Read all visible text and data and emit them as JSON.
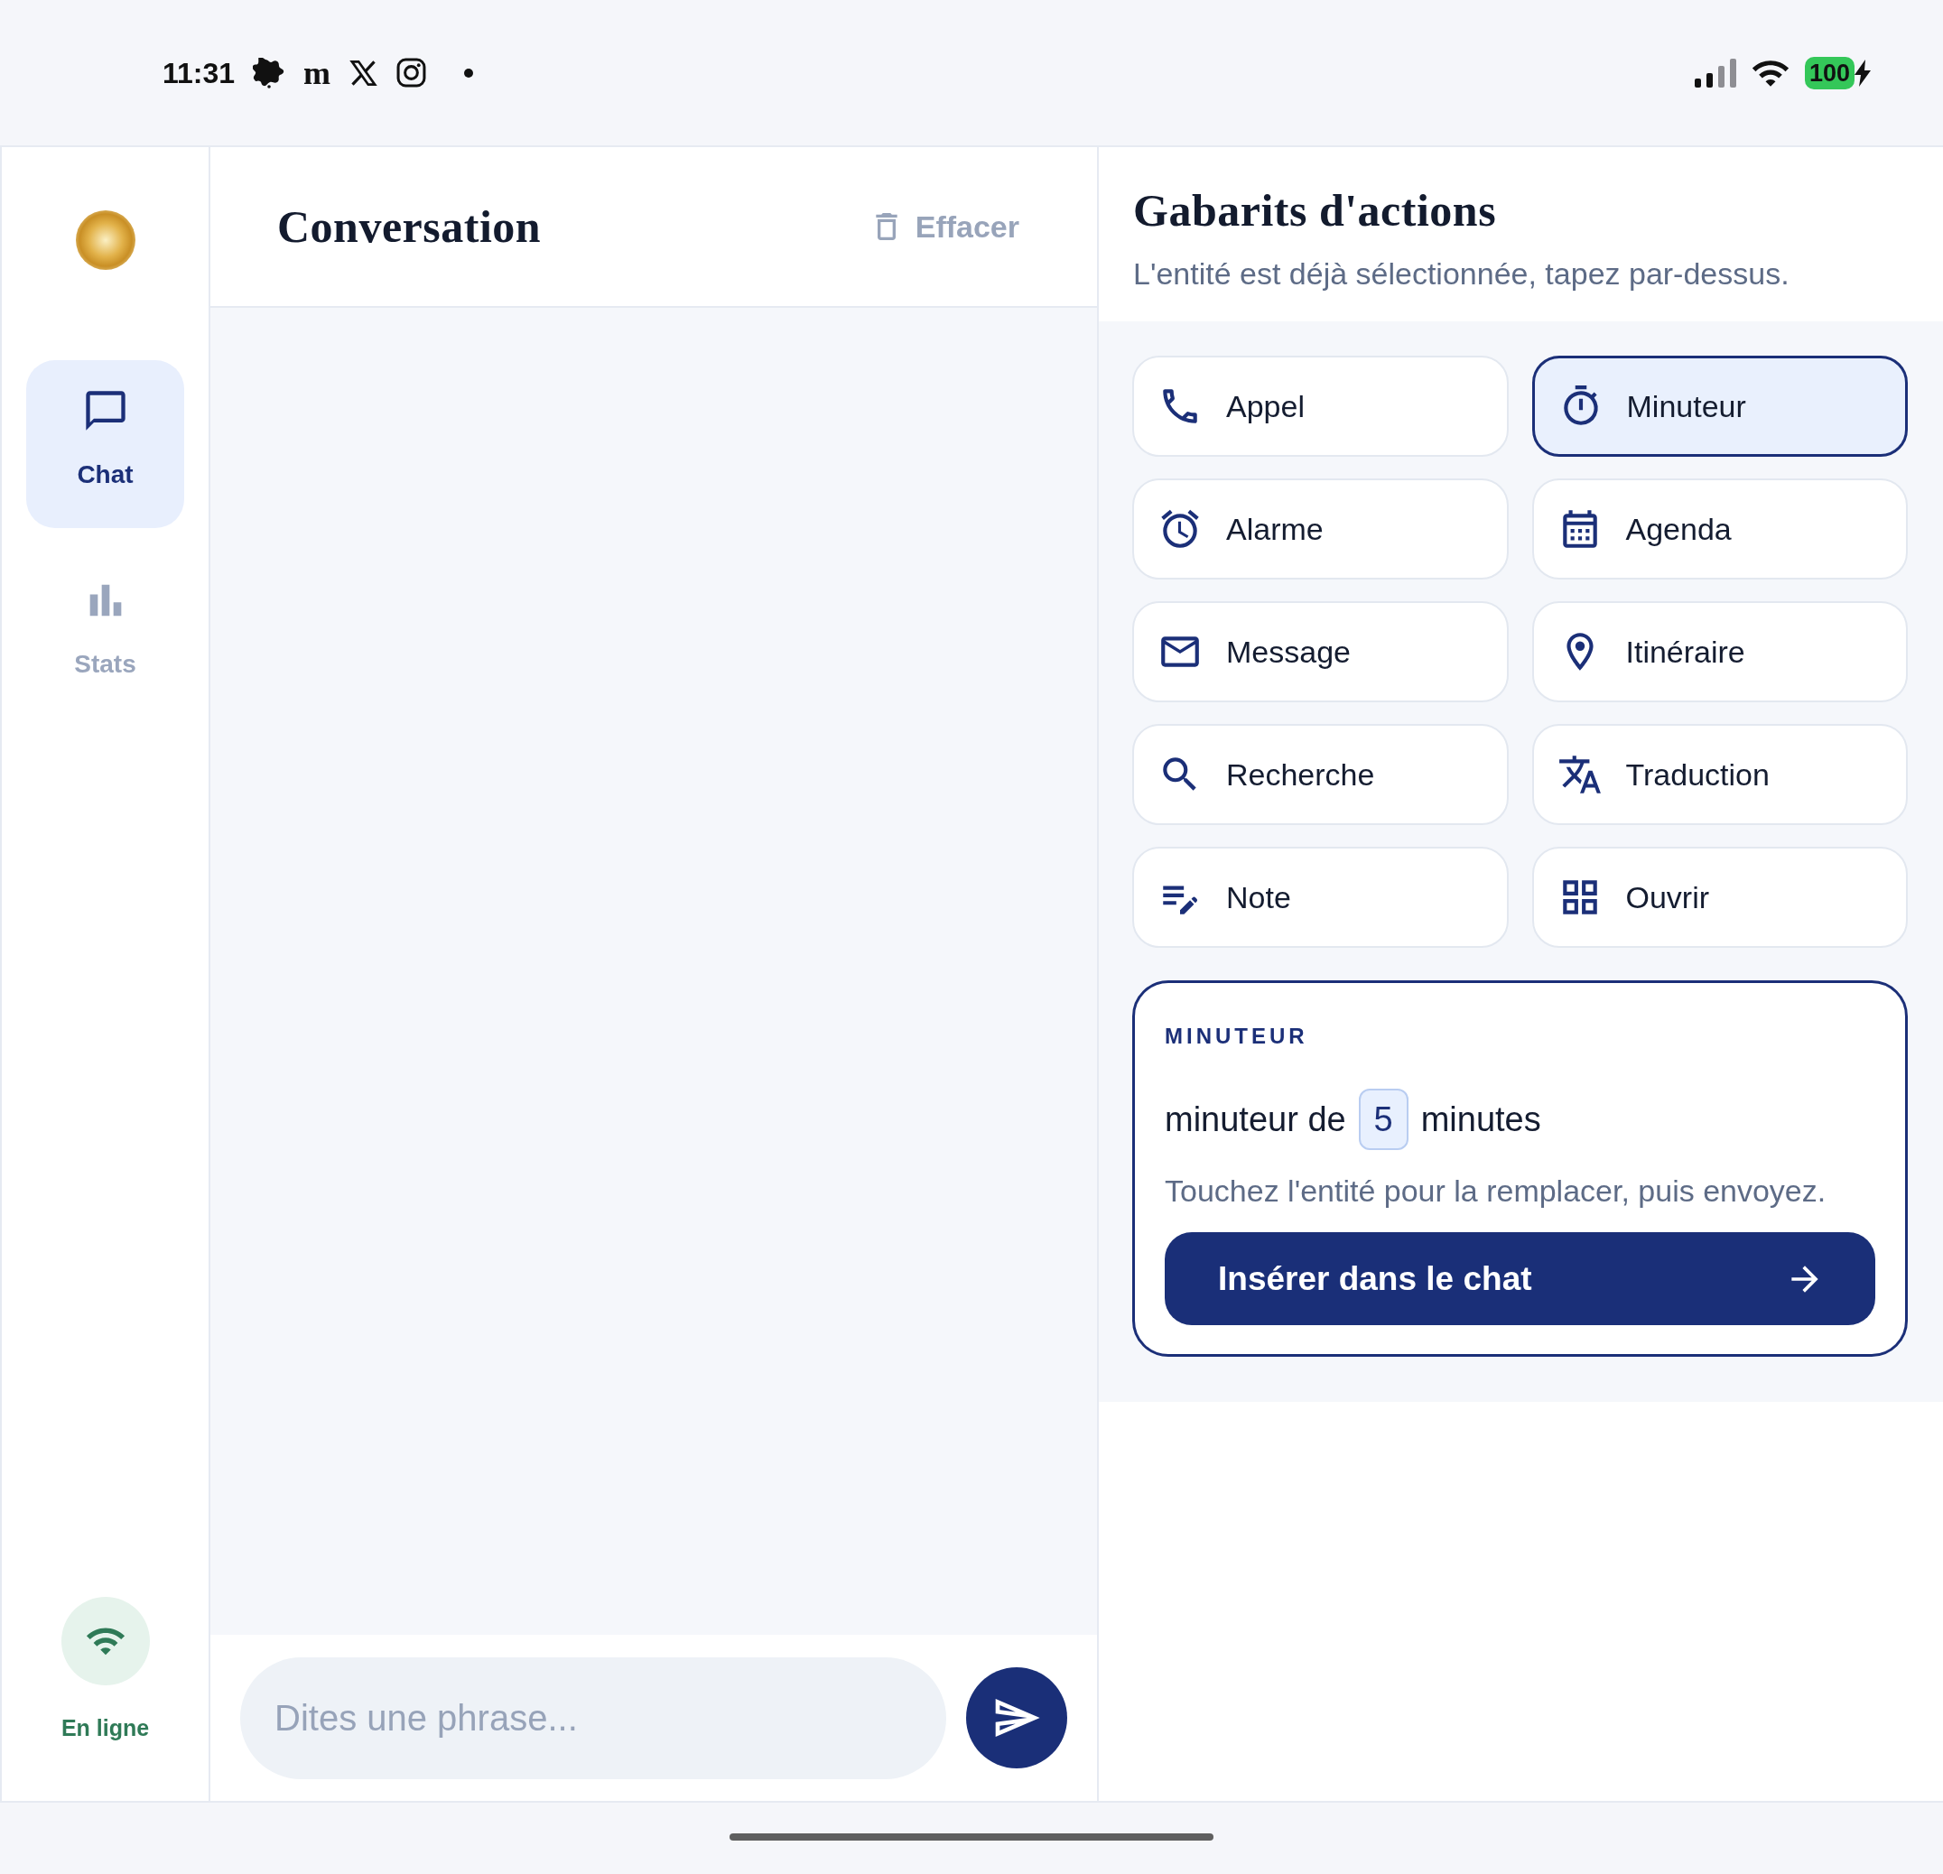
{
  "status_bar": {
    "time": "11:31",
    "notification_letter": "m",
    "battery": "100"
  },
  "sidebar": {
    "items": [
      {
        "label": "Chat",
        "selected": true
      },
      {
        "label": "Stats",
        "selected": false
      }
    ],
    "connection": {
      "label": "En ligne"
    }
  },
  "conversation": {
    "title": "Conversation",
    "clear_button": "Effacer",
    "input": {
      "placeholder": "Dites une phrase..."
    }
  },
  "templates": {
    "title": "Gabarits d'actions",
    "subtitle": "L'entité est déjà sélectionnée, tapez par-dessus.",
    "items": [
      {
        "label": "Appel",
        "selected": false
      },
      {
        "label": "Minuteur",
        "selected": true
      },
      {
        "label": "Alarme",
        "selected": false
      },
      {
        "label": "Agenda",
        "selected": false
      },
      {
        "label": "Message",
        "selected": false
      },
      {
        "label": "Itinéraire",
        "selected": false
      },
      {
        "label": "Recherche",
        "selected": false
      },
      {
        "label": "Traduction",
        "selected": false
      },
      {
        "label": "Note",
        "selected": false
      },
      {
        "label": "Ouvrir",
        "selected": false
      }
    ],
    "preview": {
      "heading": "MINUTEUR",
      "text_before": "minuteur de",
      "entity": "5",
      "text_after": "minutes",
      "hint": "Touchez l'entité pour la remplacer, puis envoyez.",
      "insert_button": "Insérer dans le chat"
    }
  }
}
